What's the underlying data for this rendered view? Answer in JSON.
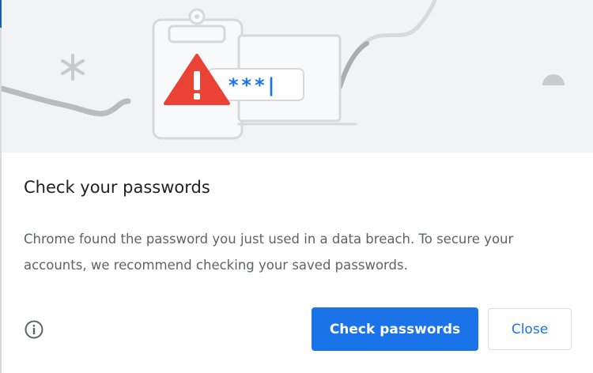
{
  "dialog": {
    "title": "Check your passwords",
    "body": "Chrome found the password you just used in a data breach. To secure your accounts, we recommend checking your saved passwords.",
    "masked_password": "***|",
    "info_icon": "info-icon",
    "primary_button": "Check passwords",
    "secondary_button": "Close"
  },
  "colors": {
    "accent": "#1a73e8",
    "warning": "#ea4335",
    "illustration_bg": "#f1f3f4"
  }
}
